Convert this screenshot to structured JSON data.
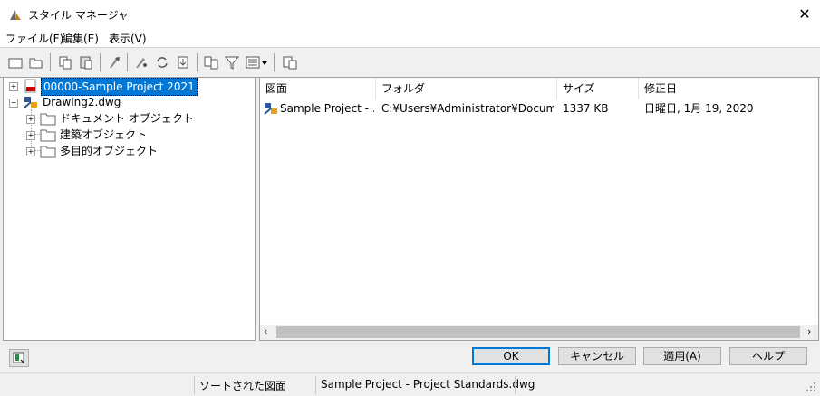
{
  "window": {
    "title": "スタイル マネージャ"
  },
  "menu": {
    "file": "ファイル(F)",
    "edit": "編集(E)",
    "view": "表示(V)"
  },
  "tree": {
    "items": [
      {
        "label": "00000-Sample Project 2021"
      },
      {
        "label": "Drawing2.dwg"
      },
      {
        "label": "ドキュメント オブジェクト"
      },
      {
        "label": "建築オブジェクト"
      },
      {
        "label": "多目的オブジェクト"
      }
    ]
  },
  "list": {
    "columns": [
      "図面",
      "フォルダ",
      "サイズ",
      "修正日"
    ],
    "rows": [
      {
        "name": "Sample Project - ...",
        "folder": "C:¥Users¥Administrator¥Documen...",
        "size": "1337 KB",
        "modified": "日曜日, 1月 19, 2020"
      }
    ]
  },
  "buttons": {
    "ok": "OK",
    "cancel": "キャンセル",
    "apply": "適用(A)",
    "help": "ヘルプ"
  },
  "status": {
    "label": "ソートされた図面",
    "value": "Sample Project - Project Standards.dwg"
  },
  "colors": {
    "accent": "#0078d7",
    "selection": "#0078d7"
  }
}
